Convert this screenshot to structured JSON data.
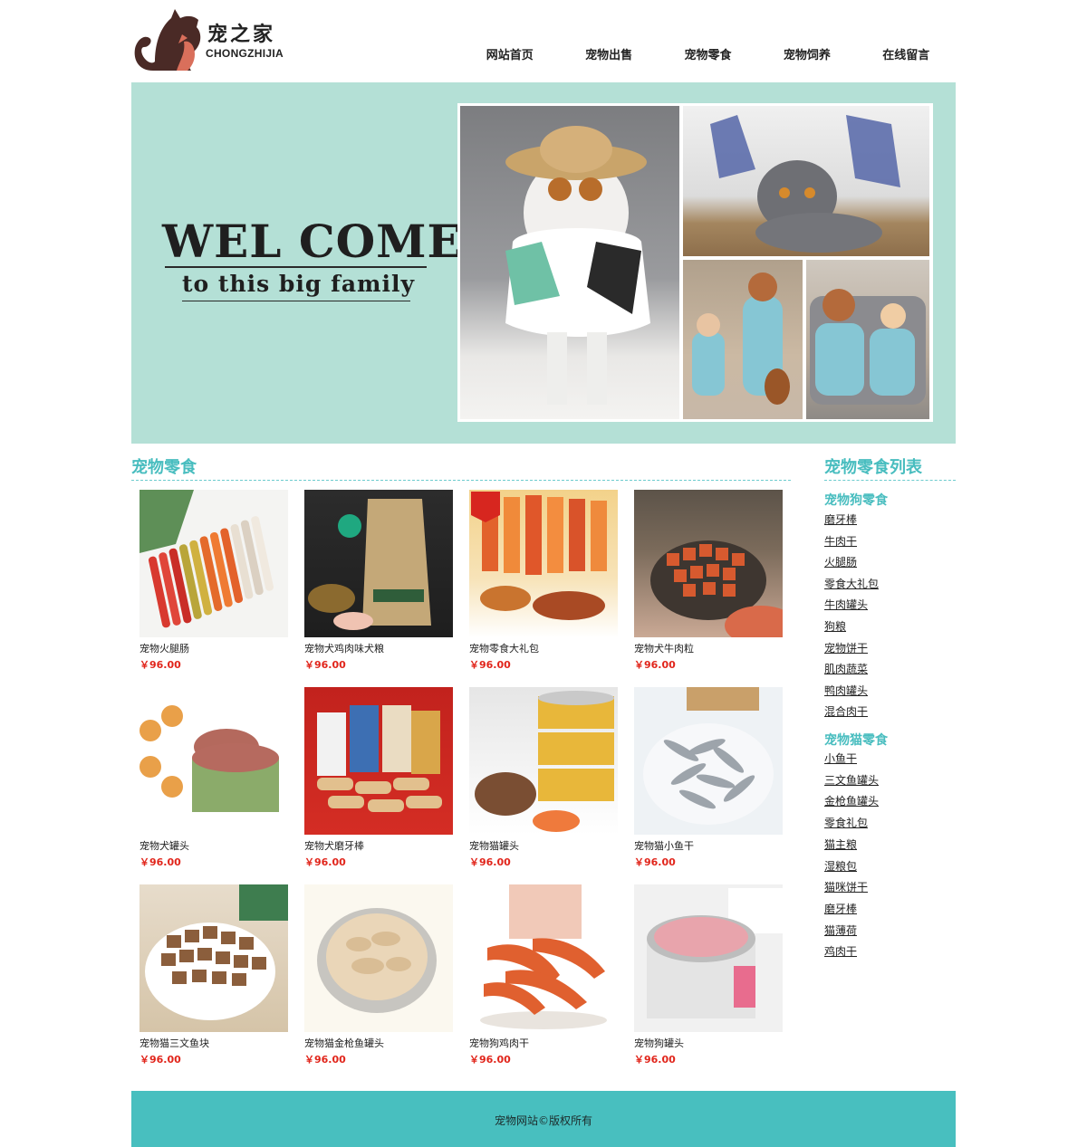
{
  "header": {
    "logo_cn": "宠之家",
    "logo_en": "CHONGZHIJIA",
    "nav": [
      "网站首页",
      "宠物出售",
      "宠物零食",
      "宠物饲养",
      "在线留言"
    ]
  },
  "banner": {
    "title": "WEL COME",
    "subtitle": "to this big family"
  },
  "main": {
    "section_title": "宠物零食",
    "products": [
      {
        "name": "宠物火腿肠",
        "price": "￥96.00"
      },
      {
        "name": "宠物犬鸡肉味犬粮",
        "price": "￥96.00"
      },
      {
        "name": "宠物零食大礼包",
        "price": "￥96.00"
      },
      {
        "name": "宠物犬牛肉粒",
        "price": "￥96.00"
      },
      {
        "name": "宠物犬罐头",
        "price": "￥96.00"
      },
      {
        "name": "宠物犬磨牙棒",
        "price": "￥96.00"
      },
      {
        "name": "宠物猫罐头",
        "price": "￥96.00"
      },
      {
        "name": "宠物猫小鱼干",
        "price": "￥96.00"
      },
      {
        "name": "宠物猫三文鱼块",
        "price": "￥96.00"
      },
      {
        "name": "宠物猫金枪鱼罐头",
        "price": "￥96.00"
      },
      {
        "name": "宠物狗鸡肉干",
        "price": "￥96.00"
      },
      {
        "name": "宠物狗罐头",
        "price": "￥96.00"
      }
    ]
  },
  "sidebar": {
    "title": "宠物零食列表",
    "categories": [
      {
        "title": "宠物狗零食",
        "items": [
          "磨牙棒",
          "牛肉干",
          "火腿肠",
          "零食大礼包",
          "牛肉罐头",
          "狗粮",
          "宠物饼干",
          "肌肉蔬菜",
          "鸭肉罐头",
          "混合肉干"
        ]
      },
      {
        "title": "宠物猫零食",
        "items": [
          "小鱼干",
          "三文鱼罐头",
          "金枪鱼罐头",
          "零食礼包",
          "猫主粮",
          "湿粮包",
          "猫咪饼干",
          "磨牙棒",
          "猫薄荷",
          "鸡肉干"
        ]
      }
    ]
  },
  "footer": {
    "text": "宠物网站©版权所有"
  },
  "colors": {
    "accent": "#48bdbf",
    "banner_bg": "#b4e0d6",
    "footer_bg": "#48bfbf",
    "price": "#e1251b"
  }
}
